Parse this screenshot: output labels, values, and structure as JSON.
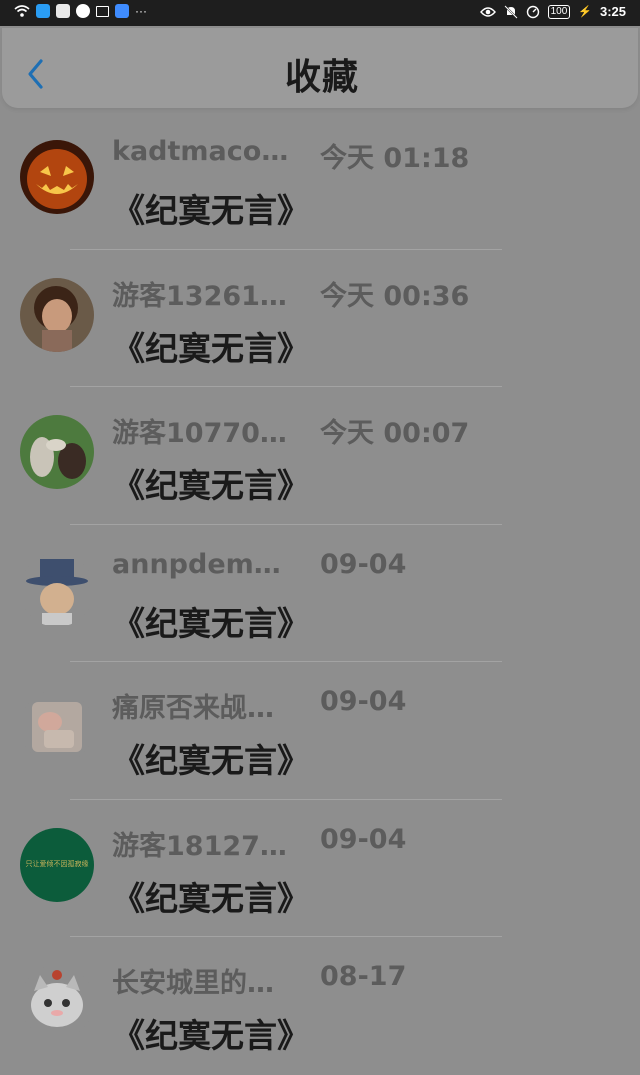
{
  "status_bar": {
    "battery": "100",
    "time": "3:25",
    "left_icons": [
      "wifi-icon",
      "qq-icon",
      "app-grid-icon",
      "wechat-icon",
      "cart-icon",
      "cloud-icon",
      "more-icon"
    ],
    "right_icons": [
      "eye-icon",
      "mute-icon",
      "data-saver-icon",
      "battery-icon",
      "charging-icon"
    ]
  },
  "header": {
    "title": "收藏",
    "back_icon": "chevron-left-icon",
    "accent": "#1e6fb4"
  },
  "favorites": [
    {
      "user": "kadtmacoc…",
      "time": "今天 01:18",
      "book": "《纪寞无言》",
      "avatar": "pumpkin"
    },
    {
      "user": "游客13261…",
      "time": "今天 00:36",
      "book": "《纪寞无言》",
      "avatar": "child"
    },
    {
      "user": "游客10770…",
      "time": "今天 00:07",
      "book": "《纪寞无言》",
      "avatar": "alpaca"
    },
    {
      "user": "annpdeme…",
      "time": "09-04",
      "book": "《纪寞无言》",
      "avatar": "cartoon-hat"
    },
    {
      "user": "痛原否来觇…",
      "time": "09-04",
      "book": "《纪寞无言》",
      "avatar": "baby"
    },
    {
      "user": "游客18127…",
      "time": "09-04",
      "book": "《纪寞无言》",
      "avatar": "green-badge",
      "avatar_text": "只让爱倾不因孤寂缘"
    },
    {
      "user": "长安城里的…",
      "time": "08-17",
      "book": "《纪寞无言》",
      "avatar": "cat"
    }
  ]
}
